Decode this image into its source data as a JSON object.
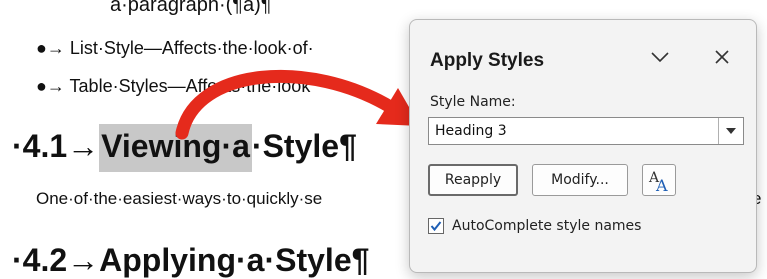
{
  "document": {
    "top_line": "a·paragraph·(¶a)¶",
    "bullet_1": "●→ List·Style—Affects·the·look·of·",
    "bullet_2": "●→ Table·Styles—Affects·the·look",
    "heading_41_num": "·4.1→",
    "heading_41_highlight": "Viewing·a",
    "heading_41_rest": "·Style¶",
    "body_text": "One·of·the·easiest·ways·to·quickly·se",
    "body_text_end": "e",
    "heading_42": "·4.2→Applying·a·Style¶"
  },
  "pane": {
    "title": "Apply Styles",
    "collapse_icon": "chevron-down-icon",
    "close_icon": "close-icon",
    "style_name_label": "Style Name:",
    "style_name_value": "Heading 3",
    "reapply_label": "Reapply",
    "modify_label": "Modify...",
    "styles_pane_icon": "styles-icon",
    "autocomplete_label": "AutoComplete style names",
    "autocomplete_checked": true
  },
  "colors": {
    "arrow": "#e52a1c",
    "highlight": "#c8c8c8",
    "pane_bg": "#f3f3f3",
    "check_accent": "#1f5fb5"
  }
}
